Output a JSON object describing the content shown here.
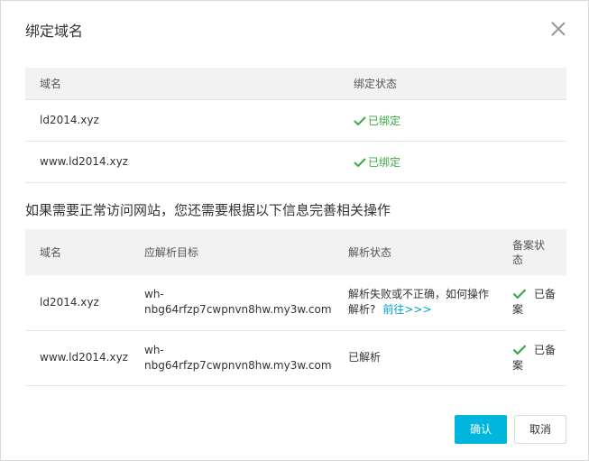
{
  "dialog": {
    "title": "绑定域名",
    "close_icon": "close-icon"
  },
  "bound_table": {
    "headers": [
      "域名",
      "绑定状态"
    ],
    "rows": [
      {
        "domain": "ld2014.xyz",
        "status": "已绑定"
      },
      {
        "domain": "www.ld2014.xyz",
        "status": "已绑定"
      }
    ]
  },
  "notice": "如果需要正常访问网站，您还需要根据以下信息完善相关操作",
  "dns_table": {
    "headers": [
      "域名",
      "应解析目标",
      "解析状态",
      "备案状态"
    ],
    "rows": [
      {
        "domain": "ld2014.xyz",
        "target_line1": "wh-",
        "target_line2": "nbg64rfzp7cwpnvn8hw.my3w.com",
        "resolve_status": "解析失败或不正确，如何操作解析?",
        "resolve_link": "前往>>>",
        "icp_status": "已备案"
      },
      {
        "domain": "www.ld2014.xyz",
        "target_line1": "wh-",
        "target_line2": "nbg64rfzp7cwpnvn8hw.my3w.com",
        "resolve_status": "已解析",
        "icp_status": "已备案"
      }
    ]
  },
  "buttons": {
    "confirm": "确认",
    "cancel": "取消"
  },
  "colors": {
    "accent": "#00b5de",
    "success": "#3da843",
    "link": "#00a2ca",
    "header_bg": "#f2f2f2"
  }
}
